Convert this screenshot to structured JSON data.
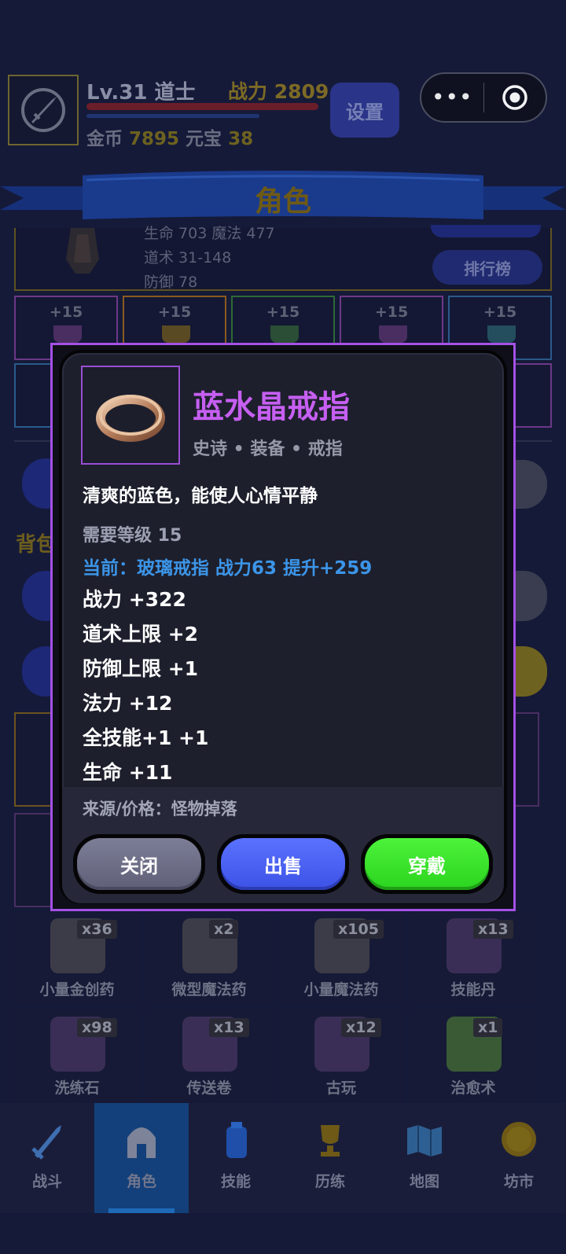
{
  "header": {
    "level_text": "Lv.31 道士",
    "power_label": "战力",
    "power_value": "2809",
    "gold_label": "金币",
    "gold_value": "7895",
    "yuanbao_label": "元宝",
    "yuanbao_value": "38",
    "settings_label": "设置",
    "capsule_more": "•••"
  },
  "banner": {
    "title": "角色"
  },
  "character": {
    "stats": [
      "生命 703  魔法 477",
      "道术 31-148",
      "防御 78"
    ],
    "rank_button": "排行榜"
  },
  "equip_slots": [
    "+15",
    "+15",
    "+15",
    "+15",
    "+15"
  ],
  "bag": {
    "label": "背包"
  },
  "items": [
    {
      "count": "x36",
      "name": "小量金创药"
    },
    {
      "count": "x2",
      "name": "微型魔法药"
    },
    {
      "count": "x105",
      "name": "小量魔法药"
    },
    {
      "count": "x13",
      "name": "技能丹"
    },
    {
      "count": "x98",
      "name": "洗练石"
    },
    {
      "count": "x13",
      "name": "传送卷"
    },
    {
      "count": "x12",
      "name": "古玩"
    },
    {
      "count": "x1",
      "name": "治愈术"
    }
  ],
  "nav": [
    {
      "label": "战斗",
      "icon": "sword-icon"
    },
    {
      "label": "角色",
      "icon": "helmet-icon"
    },
    {
      "label": "技能",
      "icon": "potion-icon"
    },
    {
      "label": "历练",
      "icon": "trophy-icon"
    },
    {
      "label": "地图",
      "icon": "map-icon"
    },
    {
      "label": "坊市",
      "icon": "coin-icon"
    }
  ],
  "modal": {
    "title": "蓝水晶戒指",
    "subtitle": "史诗 • 装备 • 戒指",
    "description": "清爽的蓝色，能使人心情平静",
    "requirement": "需要等级 15",
    "current": "当前：玻璃戒指  战力63  提升+259",
    "stats": [
      "战力 +322",
      "道术上限 +2",
      "防御上限 +1",
      "法力 +12",
      "全技能+1 +1",
      "生命 +11"
    ],
    "source": "来源/价格：怪物掉落",
    "buttons": {
      "close": "关闭",
      "sell": "出售",
      "equip": "穿戴"
    }
  },
  "colors": {
    "title_purple": "#c65ff2",
    "current_blue": "#3c95e8",
    "close_grey": "#6c6d86",
    "sell_blue": "#4a62f0",
    "equip_green": "#39e02c"
  }
}
